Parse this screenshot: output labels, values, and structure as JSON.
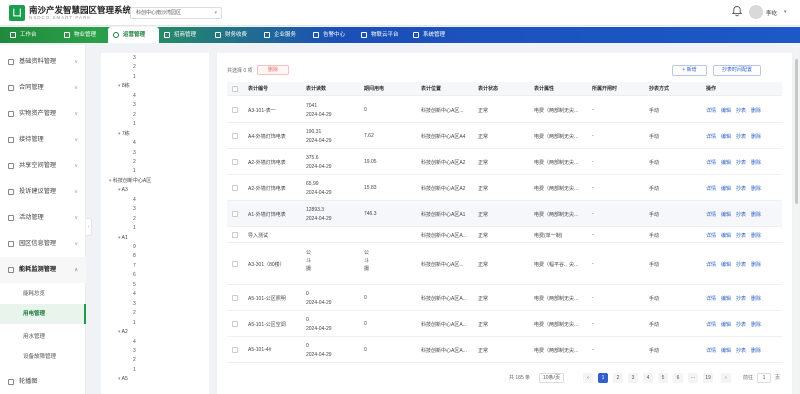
{
  "app": {
    "title": "南沙产发智慧园区管理系统",
    "subtitle": "NSDCO SMART PARK",
    "logo_text": "凵",
    "park_select": "科创中心南沙湾园区",
    "user": {
      "name": "李屹"
    }
  },
  "nav": [
    {
      "label": "工作台",
      "icon": "home-icon"
    },
    {
      "label": "物业管理",
      "icon": "building-icon"
    },
    {
      "label": "运营管理",
      "icon": "operation-icon",
      "active": true
    },
    {
      "label": "招商管理",
      "icon": "briefcase-icon"
    },
    {
      "label": "财务收费",
      "icon": "finance-icon"
    },
    {
      "label": "企业服务",
      "icon": "service-icon"
    },
    {
      "label": "告警中心",
      "icon": "alarm-icon"
    },
    {
      "label": "物联云平台",
      "icon": "link-icon"
    },
    {
      "label": "系统管理",
      "icon": "gear-icon"
    }
  ],
  "sidebar": {
    "items": [
      {
        "label": "基础资料管理",
        "icon": "doc-icon"
      },
      {
        "label": "合同管理",
        "icon": "contract-icon"
      },
      {
        "label": "实物资产管理",
        "icon": "asset-icon"
      },
      {
        "label": "接待管理",
        "icon": "reception-icon"
      },
      {
        "label": "共享空间管理",
        "icon": "share-icon"
      },
      {
        "label": "投诉建议管理",
        "icon": "complaint-icon"
      },
      {
        "label": "活动管理",
        "icon": "activity-icon"
      },
      {
        "label": "园区信息管理",
        "icon": "info-icon"
      },
      {
        "label": "能耗监测管理",
        "icon": "energy-icon",
        "open": true
      }
    ],
    "sub_items": [
      {
        "label": "能耗总览"
      },
      {
        "label": "用电管理",
        "active": true
      },
      {
        "label": "用水管理"
      },
      {
        "label": "设备故障管理"
      }
    ],
    "last_item": {
      "label": "轮播图",
      "icon": "carousel-icon"
    }
  },
  "tree": [
    {
      "text": "3",
      "indent": 2
    },
    {
      "text": "2",
      "indent": 2
    },
    {
      "text": "1",
      "indent": 2
    },
    {
      "text": "8栋",
      "indent": 1,
      "parent": true
    },
    {
      "text": "4",
      "indent": 2
    },
    {
      "text": "3",
      "indent": 2
    },
    {
      "text": "2",
      "indent": 2
    },
    {
      "text": "1",
      "indent": 2
    },
    {
      "text": "7栋",
      "indent": 1,
      "parent": true
    },
    {
      "text": "4",
      "indent": 2
    },
    {
      "text": "3",
      "indent": 2
    },
    {
      "text": "2",
      "indent": 2
    },
    {
      "text": "1",
      "indent": 2
    },
    {
      "text": "科技创新中心A区",
      "indent": 0,
      "parent": true
    },
    {
      "text": "A3",
      "indent": 1,
      "parent": true
    },
    {
      "text": "4",
      "indent": 2
    },
    {
      "text": "3",
      "indent": 2
    },
    {
      "text": "2",
      "indent": 2
    },
    {
      "text": "1",
      "indent": 2
    },
    {
      "text": "A1",
      "indent": 1,
      "parent": true
    },
    {
      "text": "9",
      "indent": 2
    },
    {
      "text": "8",
      "indent": 2
    },
    {
      "text": "7",
      "indent": 2
    },
    {
      "text": "6",
      "indent": 2
    },
    {
      "text": "5",
      "indent": 2
    },
    {
      "text": "4",
      "indent": 2
    },
    {
      "text": "3",
      "indent": 2
    },
    {
      "text": "2",
      "indent": 2
    },
    {
      "text": "1",
      "indent": 2
    },
    {
      "text": "A2",
      "indent": 1,
      "parent": true
    },
    {
      "text": "4",
      "indent": 2
    },
    {
      "text": "3",
      "indent": 2
    },
    {
      "text": "2",
      "indent": 2
    },
    {
      "text": "1",
      "indent": 2
    },
    {
      "text": "A5",
      "indent": 1,
      "parent": true
    }
  ],
  "toolbar": {
    "selected": "共选择 0 项",
    "delete": "删除",
    "add": "+ 新增",
    "config": "抄表时间配置"
  },
  "table": {
    "columns": [
      "表计编号",
      "表计读数",
      "期间用电",
      "表计位置",
      "表计状态",
      "表计属性",
      "所属开闸时",
      "抄表方式",
      "操作"
    ],
    "actions": [
      "详情",
      "编辑",
      "抄表",
      "删除"
    ],
    "rows": [
      {
        "id": "A3-101-表一",
        "reading": "7041",
        "date": "2024-04-29",
        "usage": "0",
        "loc": "科技创新中心A区...",
        "status": "正常",
        "attr": "电费（两部制无尖...",
        "switch": "-",
        "method": "手动"
      },
      {
        "id": "A4-外墙灯饰电表",
        "reading": "190.31",
        "date": "2024-04-29",
        "usage": "7.62",
        "loc": "科技创新中心A区A4",
        "status": "正常",
        "attr": "电费（两部制无尖...",
        "switch": "-",
        "method": "手动"
      },
      {
        "id": "A2-外墙灯饰电表",
        "reading": "375.6",
        "date": "2024-04-29",
        "usage": "19.05",
        "loc": "科技创新中心A区A2",
        "status": "正常",
        "attr": "电费（两部制无尖...",
        "switch": "-",
        "method": "手动"
      },
      {
        "id": "A2-外墙灯饰电表",
        "reading": "65.99",
        "date": "2024-04-29",
        "usage": "15.83",
        "loc": "科技创新中心A区A2",
        "status": "正常",
        "attr": "电费（两部制无尖...",
        "switch": "-",
        "method": "手动"
      },
      {
        "id": "A1-外墙灯饰电表",
        "reading": "12893.3",
        "date": "2024-04-29",
        "usage": "746.3",
        "loc": "科技创新中心A区A1",
        "status": "正常",
        "attr": "电费（两部制无尖...",
        "switch": "-",
        "method": "手动"
      },
      {
        "id": "导入测试",
        "reading": "",
        "date": "",
        "usage": "",
        "loc": "科技创新中心A区A...",
        "status": "正常",
        "attr": "电费(单一制)",
        "switch": "-",
        "method": "手动"
      },
      {
        "id": "A3-301（80楼）",
        "reading": "公\n斗\n摄",
        "date": "",
        "usage": "公\n斗\n摄",
        "loc": "科技创新中心A区...",
        "status": "正常",
        "attr": "电费（幅平谷、尖...",
        "switch": "-",
        "method": "手动"
      },
      {
        "id": "A5-101-公区照明",
        "reading": "0",
        "date": "2024-04-29",
        "usage": "0",
        "loc": "科技创新中心A区A...",
        "status": "正常",
        "attr": "电费（两部制无尖...",
        "switch": "-",
        "method": "手动"
      },
      {
        "id": "A5-101-公区空调",
        "reading": "0",
        "date": "2024-04-29",
        "usage": "0",
        "loc": "科技创新中心A区A...",
        "status": "正常",
        "attr": "电费（两部制无尖...",
        "switch": "-",
        "method": "手动"
      },
      {
        "id": "A5-101-4#",
        "reading": "0",
        "date": "2024-04-29",
        "usage": "0",
        "loc": "科技创新中心A区A...",
        "status": "正常",
        "attr": "电费（两部制无尖...",
        "switch": "-",
        "method": "手动"
      }
    ]
  },
  "pagination": {
    "total": "共 185 条",
    "page_size": "10条/页",
    "prev": "‹",
    "pages": [
      "1",
      "2",
      "3",
      "4",
      "5",
      "6",
      "···",
      "19"
    ],
    "current": "1",
    "next": "›",
    "goto_label": "前往",
    "goto_value": "1",
    "goto_unit": "页"
  }
}
